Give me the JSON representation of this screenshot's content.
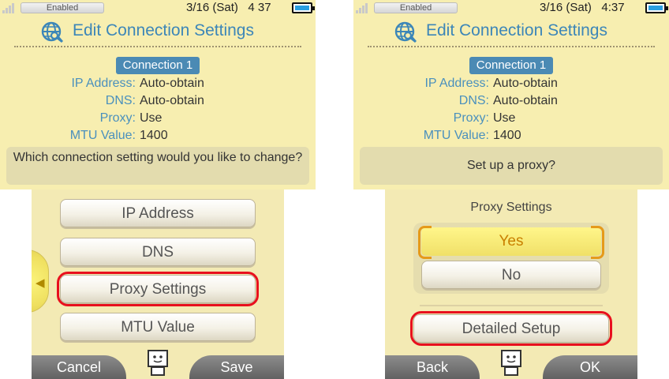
{
  "colors": {
    "accent": "#3c86b8",
    "highlight": "#e8101e",
    "badge": "#4b8ab4",
    "top_bg": "#f7eeb0"
  },
  "left": {
    "status": {
      "wifi": "Enabled",
      "date": "3/16 (Sat)",
      "time": "4 37"
    },
    "title": "Edit Connection Settings",
    "connection": "Connection 1",
    "info": [
      {
        "label": "IP Address:",
        "value": "Auto-obtain"
      },
      {
        "label": "DNS:",
        "value": "Auto-obtain"
      },
      {
        "label": "Proxy:",
        "value": "Use"
      },
      {
        "label": "MTU Value:",
        "value": "1400"
      }
    ],
    "question": "Which connection setting would you like to change?",
    "menu": [
      "IP Address",
      "DNS",
      "Proxy Settings",
      "MTU Value"
    ],
    "highlighted": "Proxy Settings",
    "footer": {
      "left": "Cancel",
      "right": "Save"
    }
  },
  "right": {
    "status": {
      "wifi": "Enabled",
      "date": "3/16 (Sat)",
      "time": "4:37"
    },
    "title": "Edit Connection Settings",
    "connection": "Connection 1",
    "info": [
      {
        "label": "IP Address:",
        "value": "Auto-obtain"
      },
      {
        "label": "DNS:",
        "value": "Auto-obtain"
      },
      {
        "label": "Proxy:",
        "value": "Use"
      },
      {
        "label": "MTU Value:",
        "value": "1400"
      }
    ],
    "question": "Set up a proxy?",
    "proxy_heading": "Proxy Settings",
    "yes": "Yes",
    "no": "No",
    "detailed": "Detailed Setup",
    "footer": {
      "left": "Back",
      "right": "OK"
    }
  },
  "icons": [
    "signal-icon",
    "battery-icon",
    "globe-wrench-icon",
    "back-arrow-icon",
    "mascot-icon"
  ]
}
